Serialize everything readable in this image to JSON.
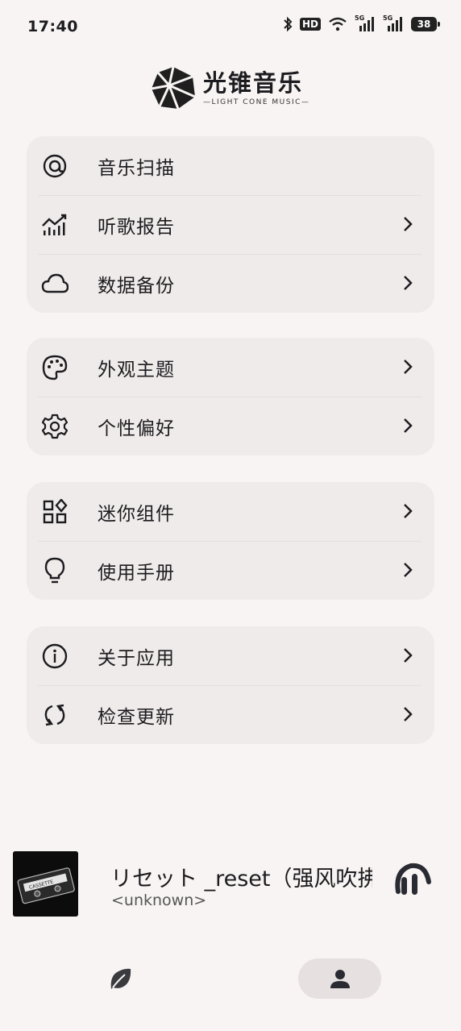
{
  "status_bar": {
    "time": "17:40",
    "hd_label": "HD",
    "network_1": "5G",
    "network_2": "5G",
    "battery": "38"
  },
  "app": {
    "title": "光锥音乐",
    "subtitle": "—LIGHT CONE MUSIC—"
  },
  "menu_groups": [
    {
      "items": [
        {
          "label": "音乐扫描",
          "icon": "at-scan-icon",
          "has_chevron": false
        },
        {
          "label": "听歌报告",
          "icon": "chart-icon",
          "has_chevron": true
        },
        {
          "label": "数据备份",
          "icon": "cloud-icon",
          "has_chevron": true
        }
      ]
    },
    {
      "items": [
        {
          "label": "外观主题",
          "icon": "palette-icon",
          "has_chevron": true
        },
        {
          "label": "个性偏好",
          "icon": "gear-icon",
          "has_chevron": true
        }
      ]
    },
    {
      "items": [
        {
          "label": "迷你组件",
          "icon": "widgets-icon",
          "has_chevron": true
        },
        {
          "label": "使用手册",
          "icon": "lightbulb-icon",
          "has_chevron": true
        }
      ]
    },
    {
      "items": [
        {
          "label": "关于应用",
          "icon": "info-icon",
          "has_chevron": true
        },
        {
          "label": "检查更新",
          "icon": "sync-icon",
          "has_chevron": true
        }
      ]
    }
  ],
  "player": {
    "song_title": "リセット _reset（强风吹拂",
    "artist": "<unknown>",
    "cover_text": "CASSETTE"
  },
  "colors": {
    "background": "#f8f4f3",
    "card": "#efebea",
    "text": "#1c1b1f",
    "nav_active": "#e6e1e0"
  }
}
